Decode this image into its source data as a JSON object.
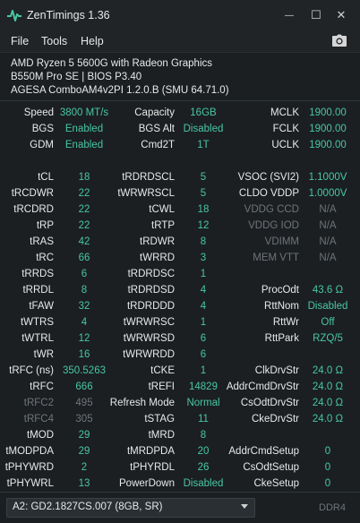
{
  "window": {
    "title": "ZenTimings 1.36",
    "minimize_glyph": "—",
    "maximize_glyph": "☐",
    "close_glyph": "✕",
    "accent_color": "#49c6a4",
    "dim_color": "#6f7478"
  },
  "menu": {
    "file": "File",
    "tools": "Tools",
    "help": "Help",
    "screenshot_icon": "camera-icon"
  },
  "system": {
    "cpu": "AMD Ryzen 5 5600G with Radeon Graphics",
    "board": "B550M Pro SE | BIOS P3.40",
    "agesa": "AGESA ComboAM4v2PI 1.2.0.B (SMU 64.71.0)"
  },
  "rows": [
    [
      {
        "l": "Speed",
        "v": "3800 MT/s"
      },
      {
        "l": "Capacity",
        "v": "16GB"
      },
      {
        "l": "MCLK",
        "v": "1900.00"
      }
    ],
    [
      {
        "l": "BGS",
        "v": "Enabled"
      },
      {
        "l": "BGS Alt",
        "v": "Disabled"
      },
      {
        "l": "FCLK",
        "v": "1900.00"
      }
    ],
    [
      {
        "l": "GDM",
        "v": "Enabled"
      },
      {
        "l": "Cmd2T",
        "v": "1T"
      },
      {
        "l": "UCLK",
        "v": "1900.00"
      }
    ],
    null,
    [
      {
        "l": "tCL",
        "v": "18"
      },
      {
        "l": "tRDRDSCL",
        "v": "5"
      },
      {
        "l": "VSOC (SVI2)",
        "v": "1.1000V"
      }
    ],
    [
      {
        "l": "tRCDWR",
        "v": "22"
      },
      {
        "l": "tWRWRSCL",
        "v": "5"
      },
      {
        "l": "CLDO VDDP",
        "v": "1.0000V"
      }
    ],
    [
      {
        "l": "tRCDRD",
        "v": "22"
      },
      {
        "l": "tCWL",
        "v": "18"
      },
      {
        "l": "VDDG CCD",
        "v": "N/A",
        "dim": true
      }
    ],
    [
      {
        "l": "tRP",
        "v": "22"
      },
      {
        "l": "tRTP",
        "v": "12"
      },
      {
        "l": "VDDG IOD",
        "v": "N/A",
        "dim": true
      }
    ],
    [
      {
        "l": "tRAS",
        "v": "42"
      },
      {
        "l": "tRDWR",
        "v": "8"
      },
      {
        "l": "VDIMM",
        "v": "N/A",
        "dim": true
      }
    ],
    [
      {
        "l": "tRC",
        "v": "66"
      },
      {
        "l": "tWRRD",
        "v": "3"
      },
      {
        "l": "MEM VTT",
        "v": "N/A",
        "dim": true
      }
    ],
    [
      {
        "l": "tRRDS",
        "v": "6"
      },
      {
        "l": "tRDRDSC",
        "v": "1"
      },
      null
    ],
    [
      {
        "l": "tRRDL",
        "v": "8"
      },
      {
        "l": "tRDRDSD",
        "v": "4"
      },
      {
        "l": "ProcOdt",
        "v": "43.6 Ω"
      }
    ],
    [
      {
        "l": "tFAW",
        "v": "32"
      },
      {
        "l": "tRDRDDD",
        "v": "4"
      },
      {
        "l": "RttNom",
        "v": "Disabled"
      }
    ],
    [
      {
        "l": "tWTRS",
        "v": "4"
      },
      {
        "l": "tWRWRSC",
        "v": "1"
      },
      {
        "l": "RttWr",
        "v": "Off"
      }
    ],
    [
      {
        "l": "tWTRL",
        "v": "12"
      },
      {
        "l": "tWRWRSD",
        "v": "6"
      },
      {
        "l": "RttPark",
        "v": "RZQ/5"
      }
    ],
    [
      {
        "l": "tWR",
        "v": "16"
      },
      {
        "l": "tWRWRDD",
        "v": "6"
      },
      null
    ],
    [
      {
        "l": "tRFC (ns)",
        "v": "350.5263"
      },
      {
        "l": "tCKE",
        "v": "1"
      },
      {
        "l": "ClkDrvStr",
        "v": "24.0 Ω"
      }
    ],
    [
      {
        "l": "tRFC",
        "v": "666"
      },
      {
        "l": "tREFI",
        "v": "14829"
      },
      {
        "l": "AddrCmdDrvStr",
        "v": "24.0 Ω"
      }
    ],
    [
      {
        "l": "tRFC2",
        "v": "495",
        "dim": true
      },
      {
        "l": "Refresh Mode",
        "v": "Normal"
      },
      {
        "l": "CsOdtDrvStr",
        "v": "24.0 Ω"
      }
    ],
    [
      {
        "l": "tRFC4",
        "v": "305",
        "dim": true
      },
      {
        "l": "tSTAG",
        "v": "11"
      },
      {
        "l": "CkeDrvStr",
        "v": "24.0 Ω"
      }
    ],
    [
      {
        "l": "tMOD",
        "v": "29"
      },
      {
        "l": "tMRD",
        "v": "8"
      },
      null
    ],
    [
      {
        "l": "tMODPDA",
        "v": "29"
      },
      {
        "l": "tMRDPDA",
        "v": "20"
      },
      {
        "l": "AddrCmdSetup",
        "v": "0"
      }
    ],
    [
      {
        "l": "tPHYWRD",
        "v": "2"
      },
      {
        "l": "tPHYRDL",
        "v": "26"
      },
      {
        "l": "CsOdtSetup",
        "v": "0"
      }
    ],
    [
      {
        "l": "tPHYWRL",
        "v": "13"
      },
      {
        "l": "PowerDown",
        "v": "Disabled"
      },
      {
        "l": "CkeSetup",
        "v": "0"
      }
    ]
  ],
  "footer": {
    "dimm_selected": "A2: GD2.1827CS.007 (8GB, SR)",
    "memory_type": "DDR4"
  }
}
